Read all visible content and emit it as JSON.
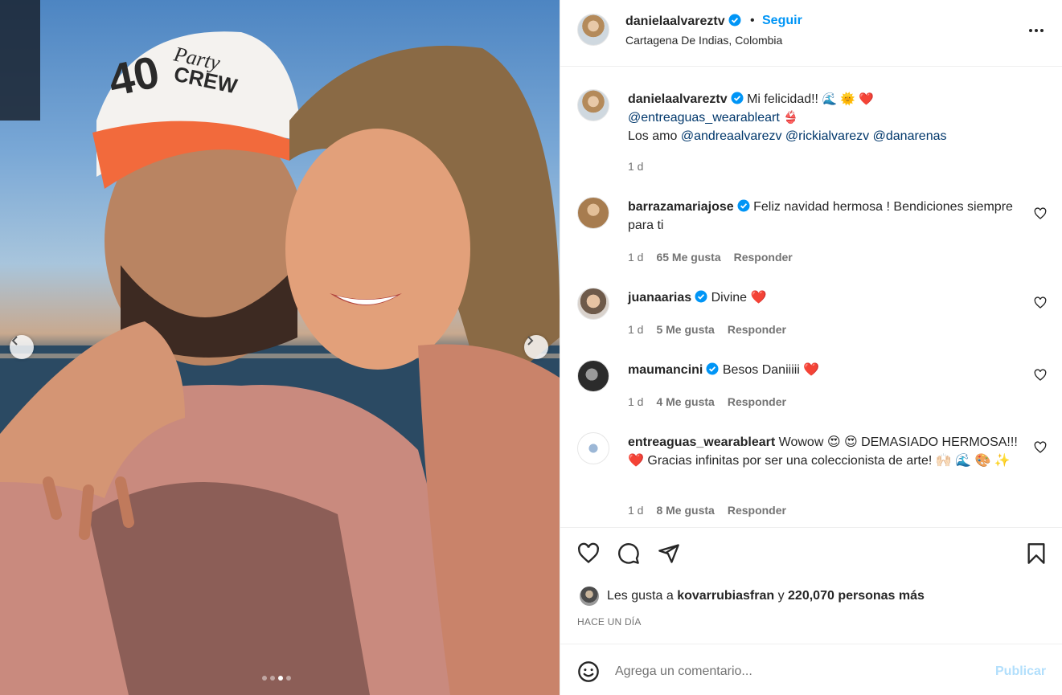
{
  "post": {
    "username": "danielaalvareztv",
    "location": "Cartagena De Indias, Colombia",
    "follow_label": "Seguir",
    "separator": "•",
    "carousel": {
      "total_slides": 4,
      "active_index": 2
    }
  },
  "caption": {
    "username": "danielaalvareztv",
    "text": "Mi felicidad!!",
    "emojis": "🌊 🌞 ❤️",
    "mention_line": "@entreaguas_wearableart",
    "mention_emoji": "👙",
    "line3_prefix": "Los amo",
    "mentions": [
      "@andreaalvarezv",
      "@rickialvarezv",
      "@danarenas"
    ],
    "time": "1 d"
  },
  "comments": [
    {
      "username": "barrazamariajose",
      "verified": true,
      "text": "Feliz navidad hermosa ! Bendiciones siempre para ti",
      "time": "1 d",
      "likes": "65 Me gusta",
      "reply": "Responder"
    },
    {
      "username": "juanaarias",
      "verified": true,
      "text": "Divine ❤️",
      "time": "1 d",
      "likes": "5 Me gusta",
      "reply": "Responder"
    },
    {
      "username": "maumancini",
      "verified": true,
      "text": "Besos Daniiiii ❤️",
      "time": "1 d",
      "likes": "4 Me gusta",
      "reply": "Responder"
    },
    {
      "username": "entreaguas_wearableart",
      "verified": false,
      "text": "Wowow 😍 😍 DEMASIADO HERMOSA!!! ❤️ Gracias infinitas por ser una coleccionista de arte! 🙌🏻 🌊 🎨 ✨",
      "time": "1 d",
      "likes": "8 Me gusta",
      "reply": "Responder"
    }
  ],
  "likes_bar": {
    "prefix": "Les gusta a",
    "user": "kovarrubiasfran",
    "conj": "y",
    "count": "220,070 personas más"
  },
  "posted_date": "HACE UN DÍA",
  "add_comment": {
    "placeholder": "Agrega un comentario...",
    "publish_label": "Publicar"
  },
  "colors": {
    "accent": "#0095f6",
    "link": "#00376b",
    "muted": "#737373",
    "heart": "#ed4956"
  },
  "icons": [
    "verified-badge-icon",
    "more-options-icon",
    "heart-icon",
    "comment-icon",
    "share-icon",
    "save-icon",
    "emoji-icon",
    "chevron-left-icon",
    "chevron-right-icon"
  ]
}
